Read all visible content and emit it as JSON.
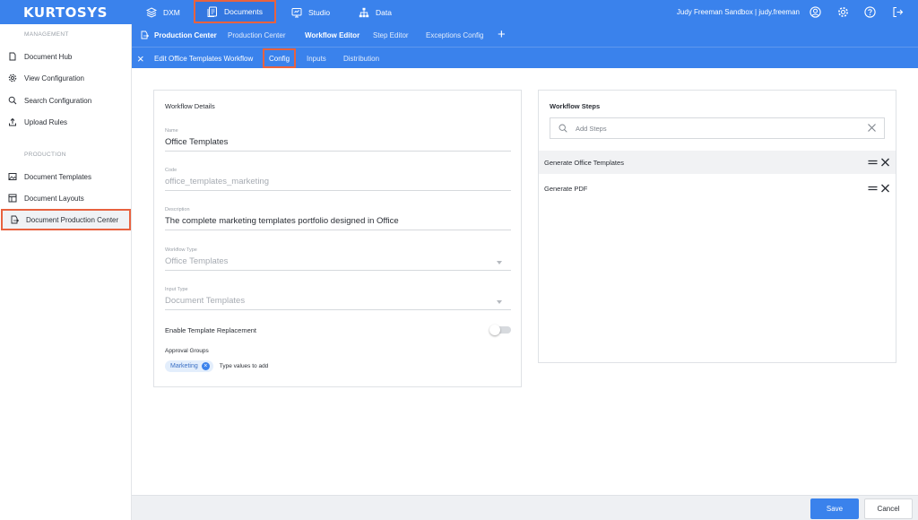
{
  "brand": {
    "logo": "KURTOSYS",
    "accent": "#3a82ec",
    "highlight": "#e8623f"
  },
  "topnav": {
    "items": [
      {
        "label": "DXM",
        "icon": "layers-icon"
      },
      {
        "label": "Documents",
        "icon": "documents-icon"
      },
      {
        "label": "Studio",
        "icon": "studio-icon"
      },
      {
        "label": "Data",
        "icon": "sitemap-icon"
      }
    ],
    "user": "Judy Freeman Sandbox | judy.freeman",
    "icons": [
      "user-circle-icon",
      "gear-icon",
      "help-icon",
      "logout-icon"
    ]
  },
  "subnav": {
    "tabs": [
      {
        "label": "Production Center",
        "bold": true
      },
      {
        "label": "Production Center"
      },
      {
        "label": "Workflow Editor",
        "bold": true
      },
      {
        "label": "Step Editor"
      },
      {
        "label": "Exceptions Config"
      }
    ],
    "add_label": "+"
  },
  "editbar": {
    "close_label": "×",
    "title": "Edit Office Templates Workflow",
    "tabs": [
      "Config",
      "Inputs",
      "Distribution"
    ]
  },
  "sidebar": {
    "management_title": "MANAGEMENT",
    "management": [
      {
        "label": "Document Hub",
        "icon": "file-icon"
      },
      {
        "label": "View Configuration",
        "icon": "gear-icon"
      },
      {
        "label": "Search Configuration",
        "icon": "search-icon"
      },
      {
        "label": "Upload Rules",
        "icon": "upload-icon"
      }
    ],
    "production_title": "PRODUCTION",
    "production": [
      {
        "label": "Document Templates",
        "icon": "image-icon"
      },
      {
        "label": "Document Layouts",
        "icon": "layout-icon"
      },
      {
        "label": "Document Production Center",
        "icon": "file-export-icon"
      }
    ]
  },
  "details": {
    "title": "Workflow Details",
    "name_label": "Name",
    "name_value": "Office Templates",
    "code_label": "Code",
    "code_value": "office_templates_marketing",
    "description_label": "Description",
    "description_value": "The complete marketing templates portfolio designed in Office",
    "workflow_type_label": "Workflow Type",
    "workflow_type_value": "Office Templates",
    "input_type_label": "Input Type",
    "input_type_value": "Document Templates",
    "toggle_label": "Enable Template Replacement",
    "approval_label": "Approval Groups",
    "chip": "Marketing",
    "chip_input_placeholder": "Type values to add"
  },
  "steps": {
    "title": "Workflow Steps",
    "search_placeholder": "Add Steps",
    "items": [
      "Generate Office Templates",
      "Generate PDF"
    ]
  },
  "footer": {
    "save": "Save",
    "cancel": "Cancel"
  }
}
